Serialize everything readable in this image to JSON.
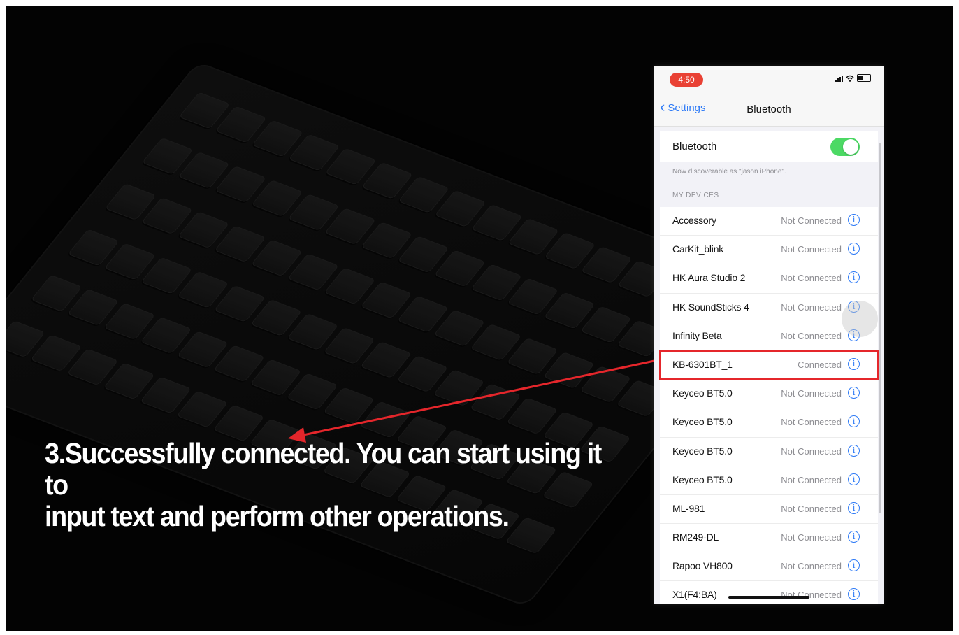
{
  "phone": {
    "status_time": "4:50",
    "nav": {
      "back_label": "Settings",
      "title": "Bluetooth"
    },
    "bluetooth_label": "Bluetooth",
    "bluetooth_on": true,
    "discoverable_text": "Now discoverable as \"jason iPhone\".",
    "section_title": "MY DEVICES",
    "devices": [
      {
        "name": "Accessory",
        "status": "Not Connected"
      },
      {
        "name": "CarKit_blink",
        "status": "Not Connected"
      },
      {
        "name": "HK Aura Studio 2",
        "status": "Not Connected"
      },
      {
        "name": "HK SoundSticks 4",
        "status": "Not Connected"
      },
      {
        "name": "Infinity Beta",
        "status": "Not Connected"
      },
      {
        "name": "KB-6301BT_1",
        "status": "Connected"
      },
      {
        "name": "Keyceo BT5.0",
        "status": "Not Connected"
      },
      {
        "name": "Keyceo BT5.0",
        "status": "Not Connected"
      },
      {
        "name": "Keyceo BT5.0",
        "status": "Not Connected"
      },
      {
        "name": "Keyceo BT5.0",
        "status": "Not Connected"
      },
      {
        "name": "ML-981",
        "status": "Not Connected"
      },
      {
        "name": "RM249-DL",
        "status": "Not Connected"
      },
      {
        "name": "Rapoo VH800",
        "status": "Not Connected"
      },
      {
        "name": "X1(F4:BA)",
        "status": "Not Connected"
      }
    ]
  },
  "caption": {
    "line1": "3.Successfully connected. You can start using it to",
    "line2": "input text and perform other operations."
  },
  "colors": {
    "highlight": "#e5262b",
    "accent": "#2f7bf6",
    "toggle_on": "#4cd964"
  }
}
